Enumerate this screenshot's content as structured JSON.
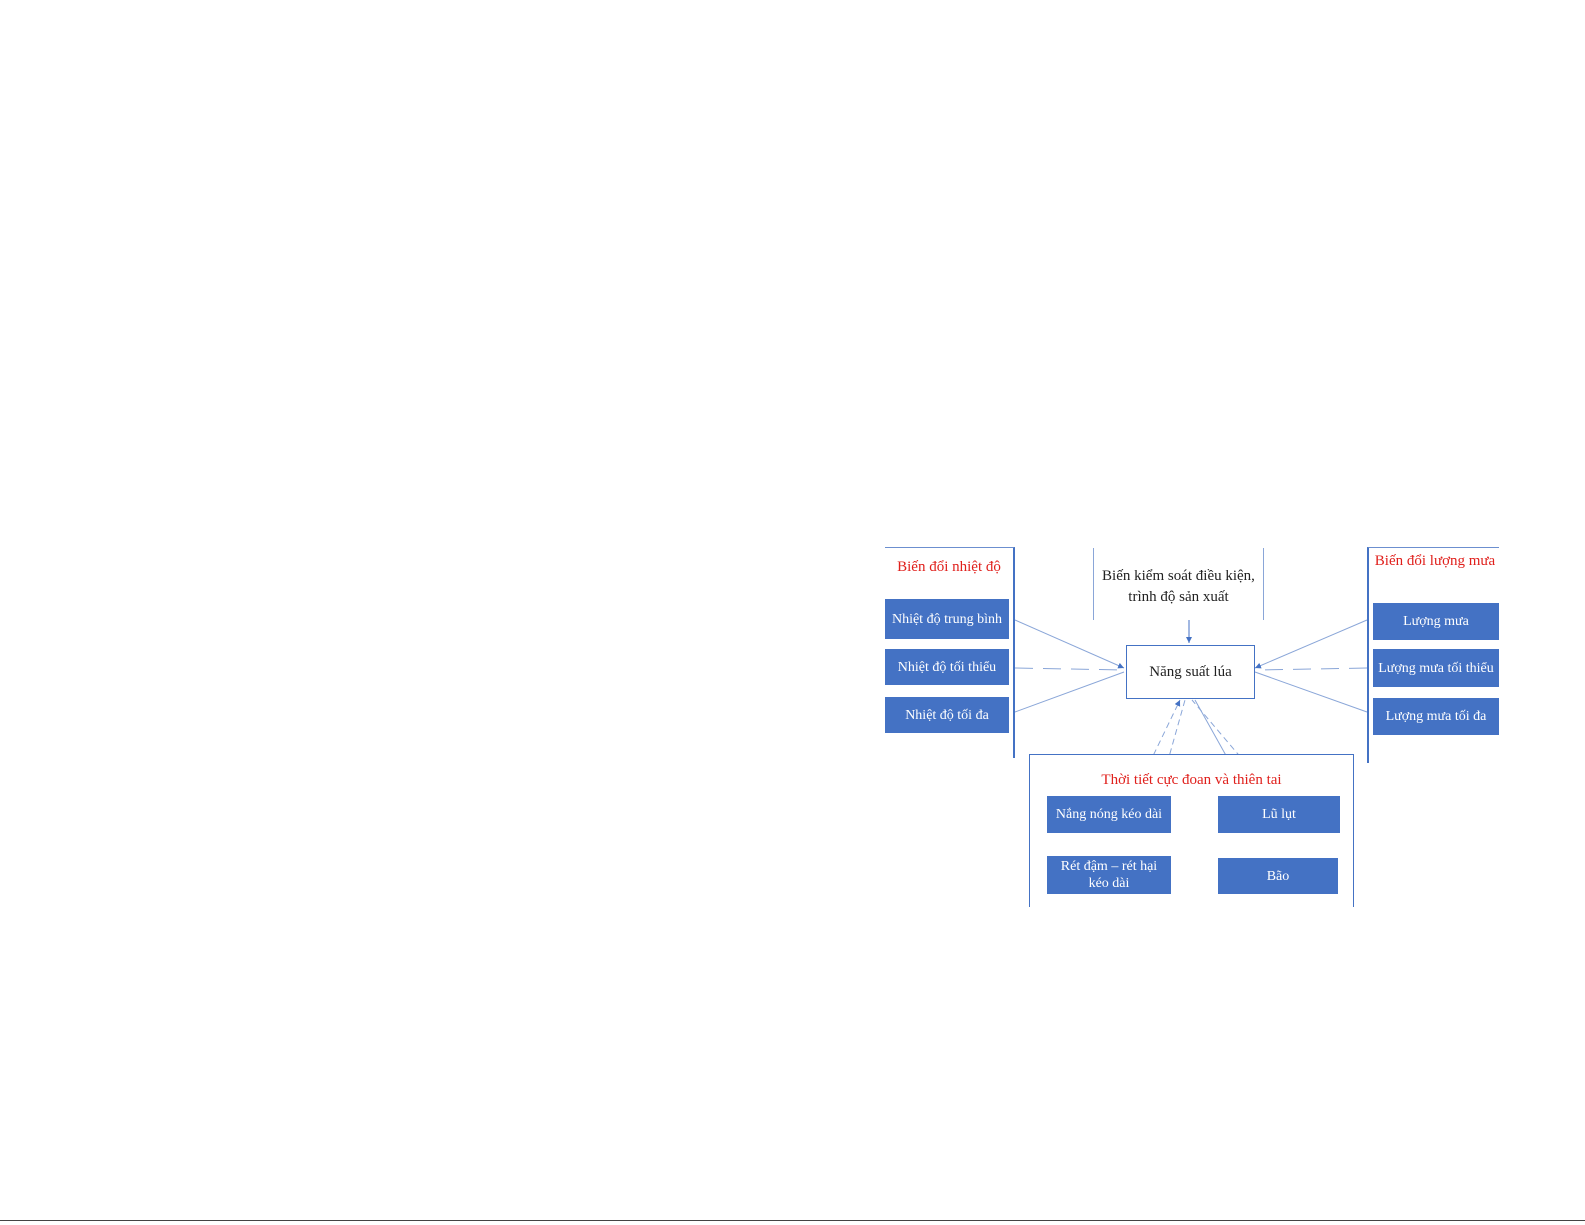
{
  "diagram": {
    "center": "Năng suất lúa",
    "control": "Biến kiểm soát điều kiện, trình độ sản xuất",
    "temperature": {
      "title": "Biến đổi nhiệt độ",
      "items": [
        "Nhiệt độ trung bình",
        "Nhiệt độ tối thiểu",
        "Nhiệt độ tối đa"
      ]
    },
    "rainfall": {
      "title": "Biến đổi lượng mưa",
      "items": [
        "Lượng mưa",
        "Lượng mưa tối thiểu",
        "Lượng mưa tối đa"
      ]
    },
    "extreme": {
      "title": "Thời tiết cực đoan và thiên tai",
      "items": [
        "Nắng nóng kéo dài",
        "Lũ lụt",
        "Rét đậm – rét hại kéo dài",
        "Bão"
      ]
    },
    "colors": {
      "box": "#4472c4",
      "title": "#e0201c",
      "arrow": "#4472c4"
    }
  }
}
